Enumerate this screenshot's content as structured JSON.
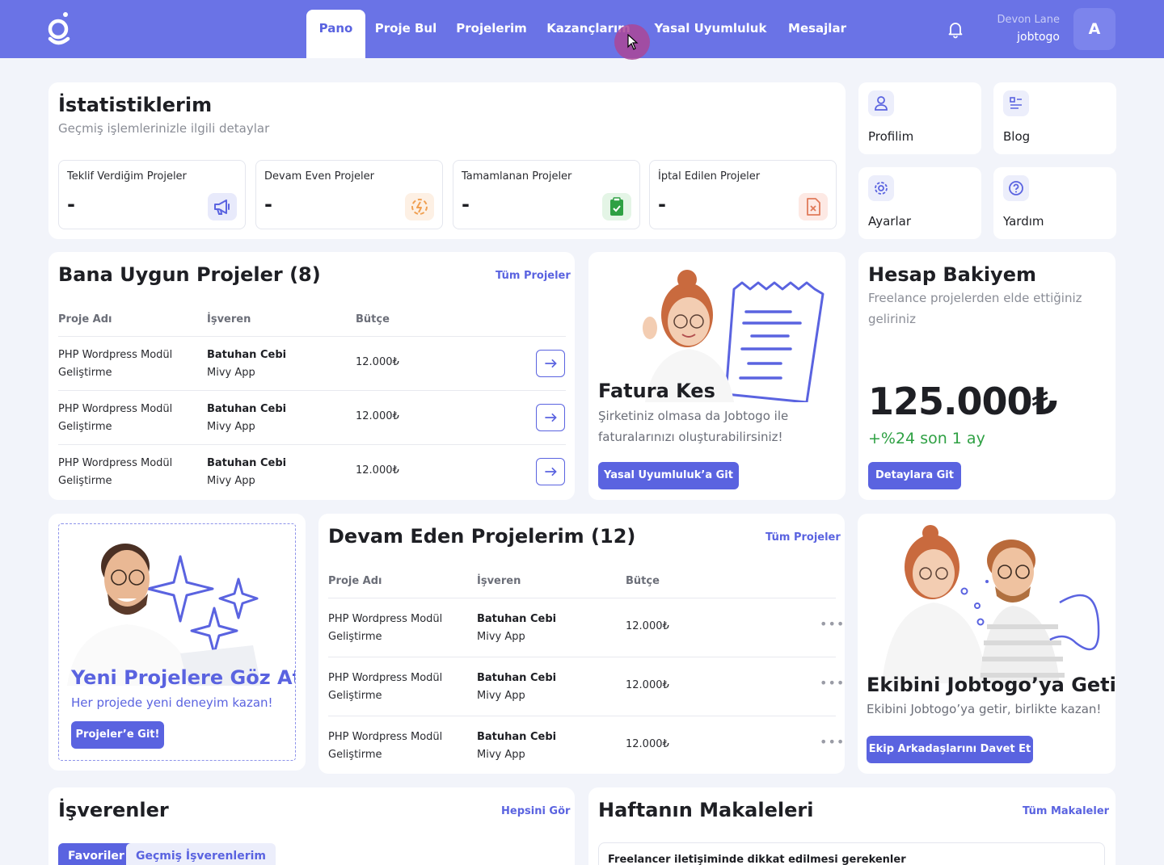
{
  "nav": {
    "items": [
      "Pano",
      "Proje Bul",
      "Projelerim",
      "Kazançlarım",
      "Yasal Uyumluluk",
      "Mesajlar"
    ],
    "user_name": "Devon Lane",
    "user_handle": "jobtogo",
    "avatar_initial": "A"
  },
  "stats": {
    "title": "İstatistiklerim",
    "subtitle": "Geçmiş işlemlerinizle ilgili detaylar",
    "items": [
      {
        "label": "Teklif Verdiğim Projeler",
        "value": "-"
      },
      {
        "label": "Devam Even Projeler",
        "value": "-"
      },
      {
        "label": "Tamamlanan Projeler",
        "value": "-"
      },
      {
        "label": "İptal Edilen Projeler",
        "value": "-"
      }
    ]
  },
  "quick_links": [
    "Profilim",
    "Blog",
    "Ayarlar",
    "Yardım"
  ],
  "suitable": {
    "title": "Bana Uygun Projeler (8)",
    "all_link": "Tüm Projeler",
    "headers": [
      "Proje Adı",
      "İşveren",
      "Bütçe"
    ],
    "rows": [
      {
        "name": "PHP Wordpress Modül Geliştirme",
        "employer": "Batuhan Cebi",
        "company": "Mivy App",
        "budget": "12.000₺"
      },
      {
        "name": "PHP Wordpress Modül Geliştirme",
        "employer": "Batuhan Cebi",
        "company": "Mivy App",
        "budget": "12.000₺"
      },
      {
        "name": "PHP Wordpress Modül Geliştirme",
        "employer": "Batuhan Cebi",
        "company": "Mivy App",
        "budget": "12.000₺"
      }
    ]
  },
  "invoice": {
    "title": "Fatura Kes",
    "text": "Şirketiniz olmasa da Jobtogo ile faturalarınızı oluşturabilirsiniz!",
    "button": "Yasal Uyumluluk’a Git"
  },
  "balance": {
    "title": "Hesap Bakiyem",
    "subtitle": "Freelance projelerden elde ettiğiniz geliriniz",
    "amount": "125.000₺",
    "change": "+%24 son 1 ay",
    "button": "Detaylara Git"
  },
  "explore": {
    "title": "Yeni Projelere Göz At",
    "subtitle": "Her projede yeni deneyim kazan!",
    "button": "Projeler’e Git!"
  },
  "ongoing": {
    "title": "Devam Eden Projelerim (12)",
    "all_link": "Tüm Projeler",
    "headers": [
      "Proje Adı",
      "İşveren",
      "Bütçe"
    ],
    "rows": [
      {
        "name": "PHP Wordpress Modül Geliştirme",
        "employer": "Batuhan Cebi",
        "company": "Mivy App",
        "budget": "12.000₺"
      },
      {
        "name": "PHP Wordpress Modül Geliştirme",
        "employer": "Batuhan Cebi",
        "company": "Mivy App",
        "budget": "12.000₺"
      },
      {
        "name": "PHP Wordpress Modül Geliştirme",
        "employer": "Batuhan Cebi",
        "company": "Mivy App",
        "budget": "12.000₺"
      }
    ]
  },
  "team": {
    "title": "Ekibini Jobtogo’ya Getir!",
    "subtitle": "Ekibini Jobtogo’ya getir, birlikte kazan!",
    "button": "Ekip Arkadaşlarını Davet Et"
  },
  "employers": {
    "title": "İşverenler",
    "all_link": "Hepsini Gör",
    "tabs": [
      "Favoriler",
      "Geçmiş İşverenlerim"
    ]
  },
  "articles": {
    "title": "Haftanın Makaleleri",
    "all_link": "Tüm Makaleler",
    "first_title": "Freelancer iletişiminde dikkat edilmesi gerekenler"
  },
  "colors": {
    "brand": "#6a73e6",
    "accent": "#5a63e0",
    "positive": "#2ea043"
  }
}
